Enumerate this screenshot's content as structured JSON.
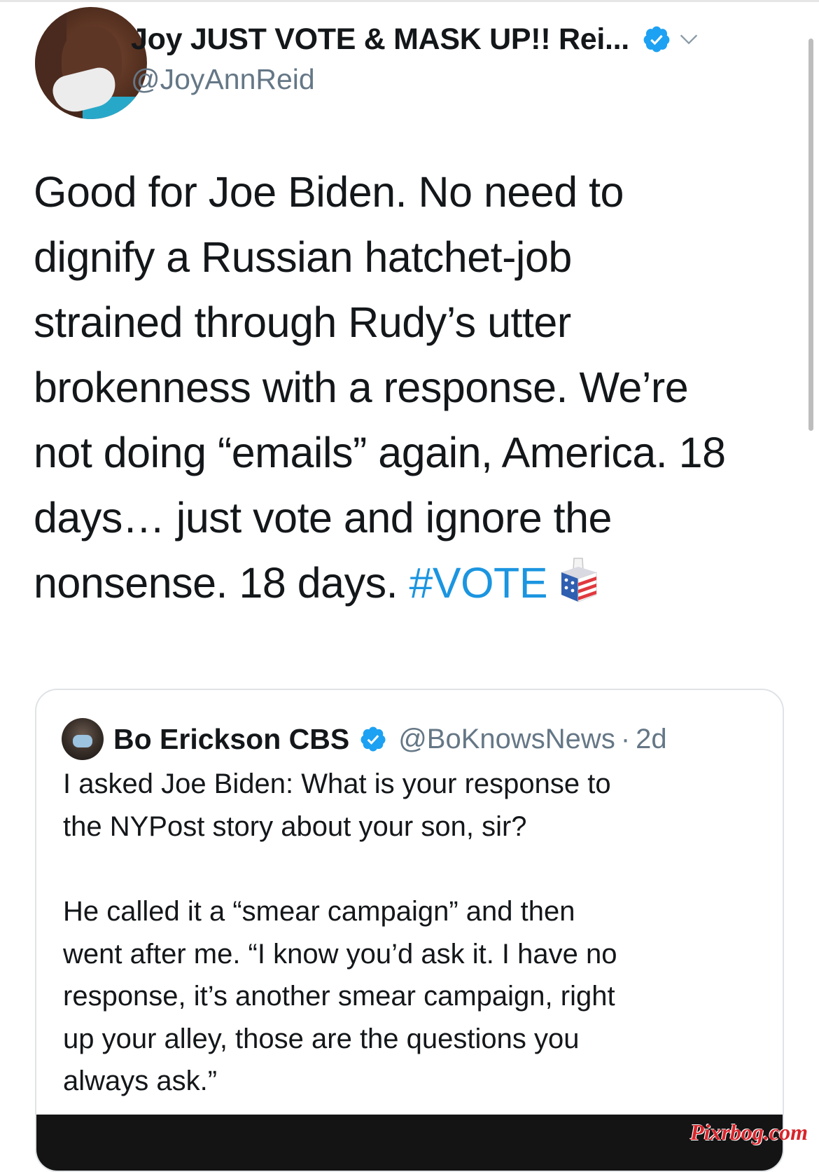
{
  "tweet": {
    "author": {
      "display_name": "Joy JUST VOTE & MASK UP!! Rei...",
      "handle": "@JoyAnnReid",
      "verified": true,
      "avatar_icon": "profile-photo"
    },
    "text_lines": [
      "Good for Joe Biden. No need to",
      "dignify a Russian hatchet-job",
      "strained through Rudy’s utter",
      "brokenness with a response. We’re",
      "not doing “emails” again, America. 18",
      "days… just vote and ignore the",
      "nonsense. 18 days. "
    ],
    "hashtag": "#VOTE",
    "emoji": "ballot-box-icon",
    "hashtag_color": "#1b95e0"
  },
  "quote": {
    "author": {
      "display_name": "Bo Erickson CBS",
      "handle": "@BoKnowsNews",
      "separator": "·",
      "time": "2d",
      "verified": true
    },
    "para1_lines": [
      "I asked Joe Biden: What is your response to",
      "the NYPost story about your son, sir?"
    ],
    "para2_lines": [
      "He called it a “smear campaign” and then",
      "went after me. “I know you’d ask it. I have no",
      "response, it’s another smear campaign, right",
      "up your alley, those are the questions you",
      "always ask.”"
    ]
  },
  "colors": {
    "text": "#14171a",
    "secondary_text": "#657786",
    "verified_blue": "#1da1f2",
    "border": "#dfe3e6",
    "watermark_red": "#d8242b"
  },
  "watermark": "Pixrbog.com"
}
